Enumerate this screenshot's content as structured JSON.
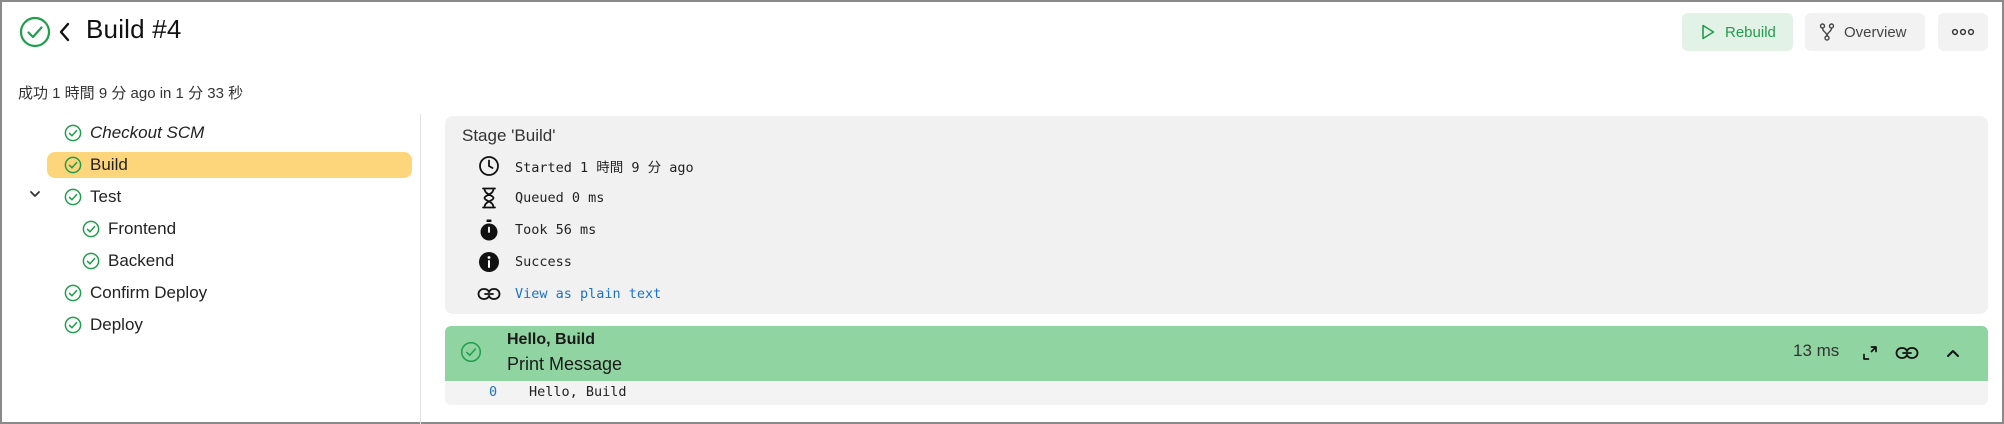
{
  "header": {
    "title": "Build #4",
    "subtitle": "成功 1 時間 9 分 ago in 1 分 33 秒",
    "buttons": {
      "rebuild": "Rebuild",
      "overview": "Overview"
    }
  },
  "sidebar": {
    "items": [
      {
        "label": "Checkout SCM",
        "icon": "check-circle-icon"
      },
      {
        "label": "Build",
        "icon": "check-circle-icon",
        "active": true
      },
      {
        "label": "Test",
        "icon": "check-circle-icon",
        "expanded": true
      },
      {
        "label": "Frontend",
        "icon": "check-circle-icon"
      },
      {
        "label": "Backend",
        "icon": "check-circle-icon"
      },
      {
        "label": "Confirm Deploy",
        "icon": "check-circle-icon"
      },
      {
        "label": "Deploy",
        "icon": "check-circle-icon"
      }
    ]
  },
  "stage": {
    "title": "Stage 'Build'",
    "started": "Started 1 時間 9 分 ago",
    "queued": "Queued 0 ms",
    "took": "Took 56 ms",
    "status": "Success",
    "plain_text_link": "View as plain text"
  },
  "step": {
    "name": "Hello, Build",
    "description": "Print Message",
    "duration": "13 ms",
    "log": [
      {
        "line": "0",
        "text": "Hello, Build"
      }
    ]
  },
  "colors": {
    "success": "#1f9e4c",
    "active_stage": "#fdd57a",
    "step_bar": "#90d4a2",
    "link": "#1a73c9"
  }
}
